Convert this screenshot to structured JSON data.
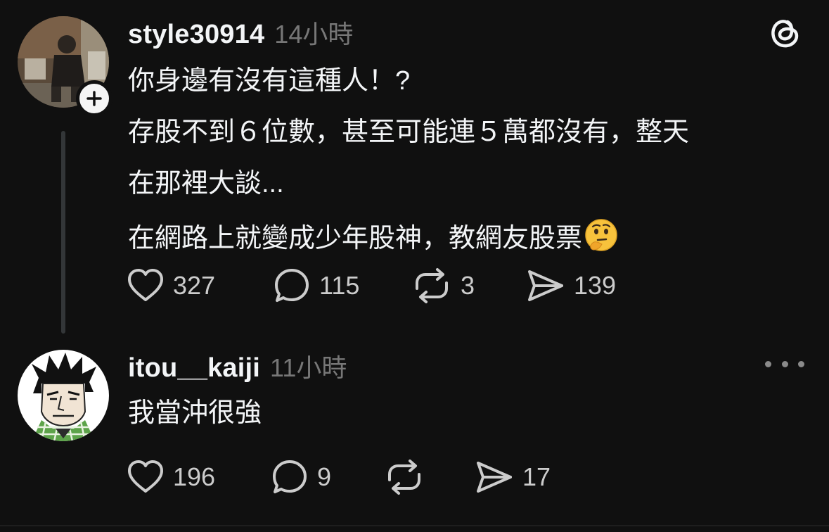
{
  "post": {
    "username": "style30914",
    "timestamp": "14小時",
    "lines": [
      "你身邊有沒有這種人！?",
      "存股不到６位數，甚至可能連５萬都沒有，整天",
      "在那裡大談...",
      "在網路上就變成少年股神，教網友股票"
    ],
    "emoji": "thinking-face",
    "likes": "327",
    "comments": "115",
    "reposts": "3",
    "shares": "139"
  },
  "reply": {
    "username": "itou__kaiji",
    "timestamp": "11小時",
    "text": "我當沖很強",
    "likes": "196",
    "comments": "9",
    "reposts": "",
    "shares": "17"
  },
  "icons": {
    "logo": "threads-logo-icon",
    "follow": "plus-icon",
    "like": "heart-icon",
    "comment": "comment-bubble-icon",
    "repost": "repost-icon",
    "share": "send-icon",
    "more": "more-horizontal-icon"
  },
  "colors": {
    "background": "#101010",
    "primary_text": "#f3f5f7",
    "secondary_text": "#777777",
    "icon": "#cccccc",
    "thread_line": "#333638"
  }
}
